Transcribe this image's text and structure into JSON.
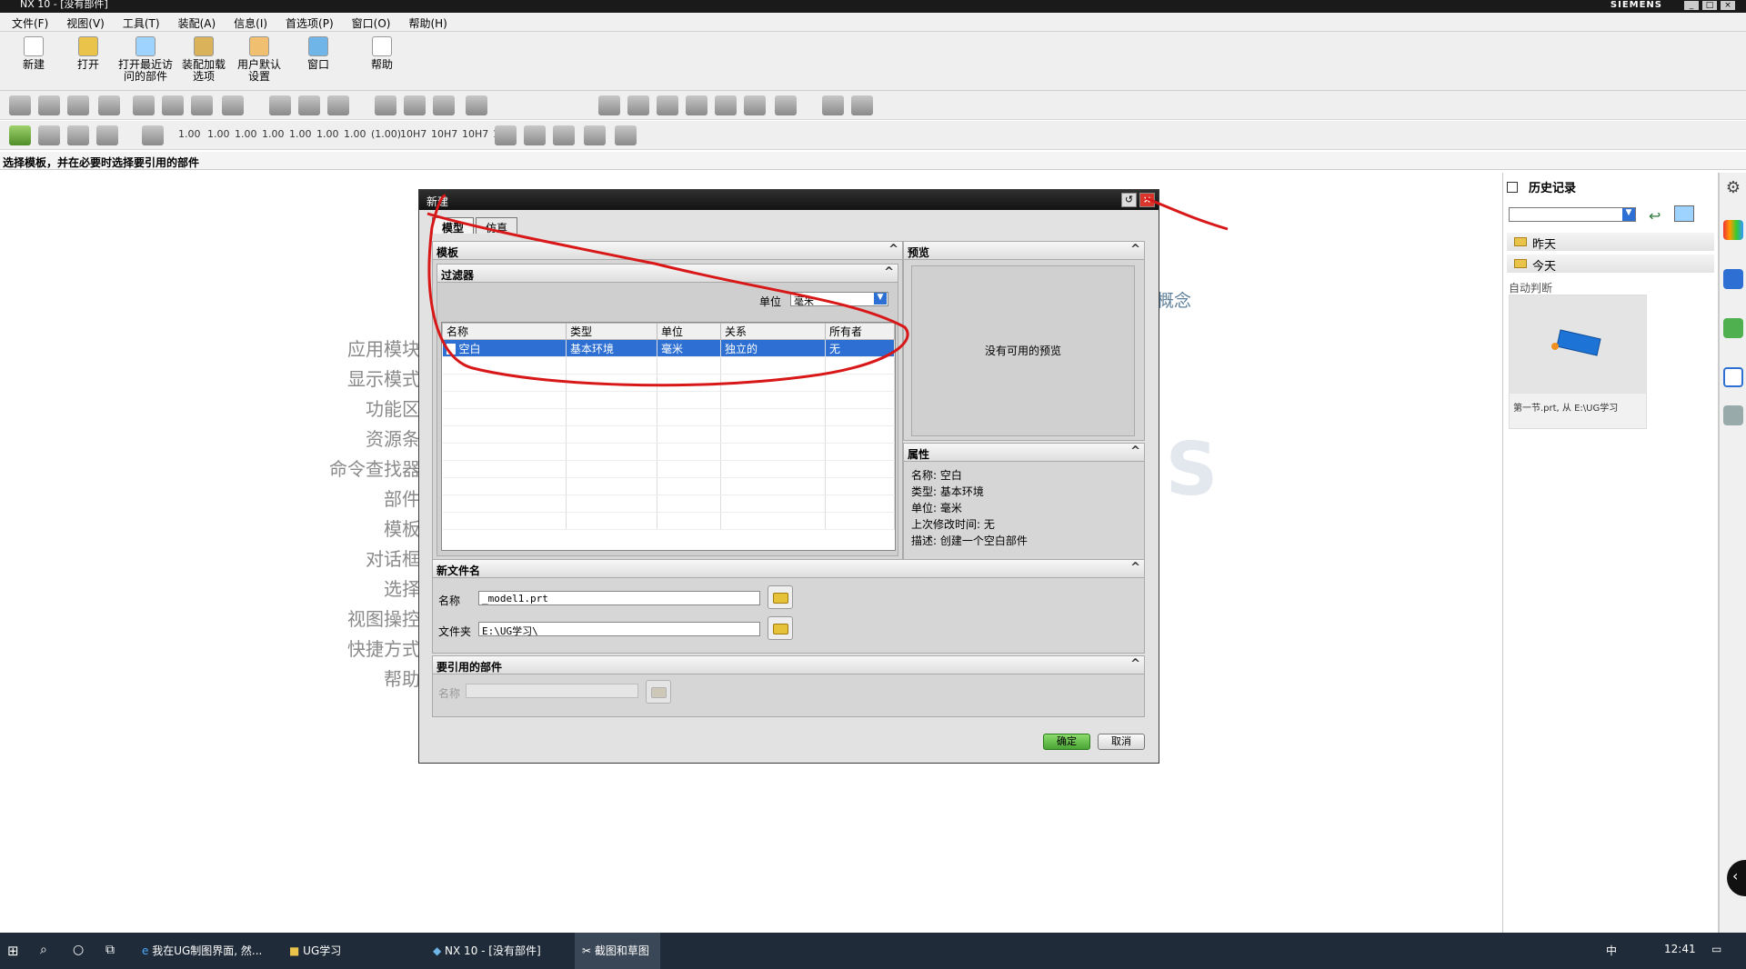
{
  "window": {
    "title": "NX 10 - [没有部件]",
    "brand": "SIEMENS"
  },
  "menu": [
    "文件(F)",
    "视图(V)",
    "工具(T)",
    "装配(A)",
    "信息(I)",
    "首选项(P)",
    "窗口(O)",
    "帮助(H)"
  ],
  "ribbon": {
    "new": "新建",
    "open": "打开",
    "recent": "打开最近访问的部件",
    "assembly_load": "装配加载选项",
    "user_defaults": "用户默认设置",
    "window": "窗口",
    "help": "帮助"
  },
  "toolbar_numbers": [
    "1.00",
    "1.00",
    "1.00",
    "1.00",
    "1.00",
    "1.00",
    "1.00",
    "(1.00)",
    "10H7",
    "10H7",
    "10H7",
    "10"
  ],
  "status": "选择模板，并在必要时选择要引用的部件",
  "background_list": [
    "应用模块",
    "显示模式",
    "功能区",
    "资源条",
    "命令查找器",
    "部件",
    "模板",
    "对话框",
    "选择",
    "视图操控",
    "快捷方式",
    "帮助"
  ],
  "background_concept": "概念",
  "dialog": {
    "title": "新建",
    "tabs": [
      "模型",
      "仿真"
    ],
    "template_header": "模板",
    "filter_header": "过滤器",
    "unit_label": "单位",
    "unit_value": "毫米",
    "columns": [
      "名称",
      "类型",
      "单位",
      "关系",
      "所有者"
    ],
    "rows": [
      [
        "空白",
        "基本环境",
        "毫米",
        "独立的",
        "无"
      ]
    ],
    "preview_header": "预览",
    "preview_text": "没有可用的预览",
    "props_header": "属性",
    "props": [
      "名称:  空白",
      "类型:  基本环境",
      "单位:  毫米",
      "上次修改时间: 无",
      "描述:  创建一个空白部件"
    ],
    "newfile_header": "新文件名",
    "name_label": "名称",
    "name_value": "_model1.prt",
    "folder_label": "文件夹",
    "folder_value": "E:\\UG学习\\",
    "ref_header": "要引用的部件",
    "ref_name_label": "名称",
    "ok": "确定",
    "cancel": "取消"
  },
  "history": {
    "title": "历史记录",
    "yesterday": "昨天",
    "today": "今天",
    "auto": "自动判断",
    "caption": "第一节.prt, 从 E:\\UG学习"
  },
  "taskbar": {
    "items": [
      "我在UG制图界面, 然...",
      "UG学习",
      "NX 10 - [没有部件]",
      "截图和草图"
    ],
    "ime": "中",
    "time": "12:41"
  }
}
